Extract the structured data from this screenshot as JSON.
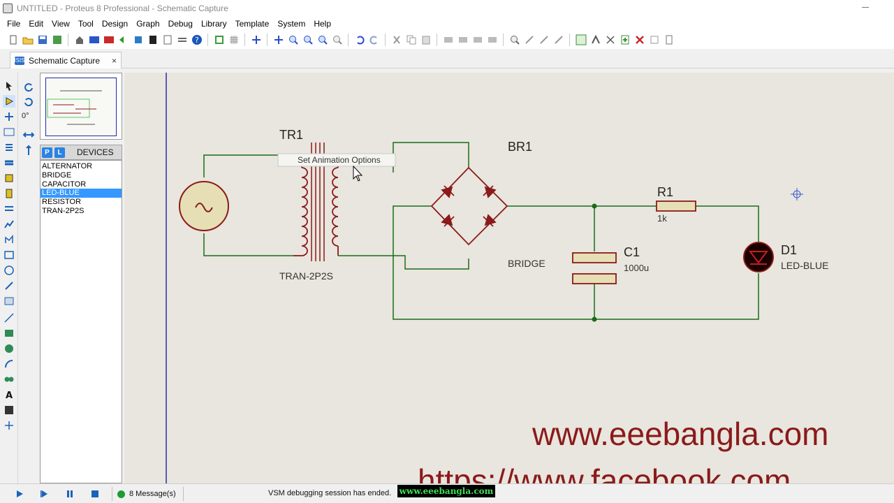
{
  "window": {
    "title": "UNTITLED - Proteus 8 Professional - Schematic Capture"
  },
  "menu": [
    "File",
    "Edit",
    "View",
    "Tool",
    "Design",
    "Graph",
    "Debug",
    "Library",
    "Template",
    "System",
    "Help"
  ],
  "tab": {
    "label": "Schematic Capture",
    "close": "×"
  },
  "rotation": {
    "angle": "0°"
  },
  "devices": {
    "p_button": "P",
    "l_button": "L",
    "title": "DEVICES",
    "items": [
      "ALTERNATOR",
      "BRIDGE",
      "CAPACITOR",
      "LED-BLUE",
      "RESISTOR",
      "TRAN-2P2S"
    ],
    "selected": "LED-BLUE"
  },
  "schematic": {
    "transformer": {
      "ref": "TR1",
      "value": "TRAN-2P2S"
    },
    "bridge": {
      "ref": "BR1",
      "value": "BRIDGE"
    },
    "resistor": {
      "ref": "R1",
      "value": "1k"
    },
    "capacitor": {
      "ref": "C1",
      "value": "1000u"
    },
    "led": {
      "ref": "D1",
      "value": "LED-BLUE"
    },
    "tooltip": "Set Animation Options",
    "watermark_1": "www.eeebangla.com",
    "watermark_2": "https://www.facebook.com",
    "colors": {
      "wire": "#1a6b1a",
      "component": "#8b1a1a",
      "canvas": "#e8e6de"
    }
  },
  "status": {
    "messages": "8 Message(s)",
    "vsm": "VSM debugging session has ended.",
    "badge": "www.eeebangla.com"
  }
}
